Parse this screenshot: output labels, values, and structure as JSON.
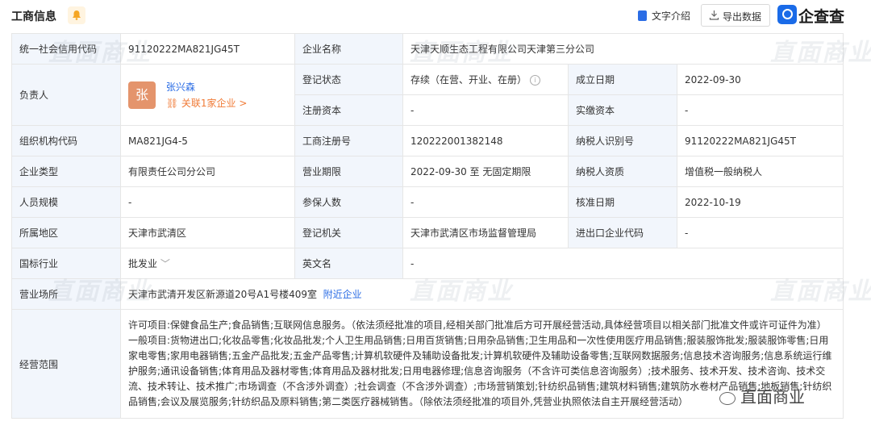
{
  "header": {
    "title": "工商信息",
    "text_intro": "文字介绍",
    "export": "导出数据",
    "logo": "企查查"
  },
  "row1": {
    "l1": "统一社会信用代码",
    "v1": "91120222MA821JG45T",
    "l2": "企业名称",
    "v2": "天津天顺生态工程有限公司天津第三分公司"
  },
  "row2": {
    "l1": "负责人",
    "avatar": "张",
    "person": "张兴森",
    "related": "关联1家企业 >",
    "l2": "登记状态",
    "v2": "存续（在营、开业、在册）",
    "l3": "成立日期",
    "v3": "2022-09-30"
  },
  "row3": {
    "l2": "注册资本",
    "v2": "-",
    "l3": "实缴资本",
    "v3": "-"
  },
  "row4": {
    "l1": "组织机构代码",
    "v1": "MA821JG4-5",
    "l2": "工商注册号",
    "v2": "120222001382148",
    "l3": "纳税人识别号",
    "v3": "91120222MA821JG45T"
  },
  "row5": {
    "l1": "企业类型",
    "v1": "有限责任公司分公司",
    "l2": "营业期限",
    "v2": "2022-09-30 至 无固定期限",
    "l3": "纳税人资质",
    "v3": "增值税一般纳税人"
  },
  "row6": {
    "l1": "人员规模",
    "v1": "-",
    "l2": "参保人数",
    "v2": "-",
    "l3": "核准日期",
    "v3": "2022-10-19"
  },
  "row7": {
    "l1": "所属地区",
    "v1": "天津市武清区",
    "l2": "登记机关",
    "v2": "天津市武清区市场监督管理局",
    "l3": "进出口企业代码",
    "v3": "-"
  },
  "row8": {
    "l1": "国标行业",
    "v1": "批发业",
    "l2": "英文名",
    "v2": "-"
  },
  "row9": {
    "l1": "营业场所",
    "v1": "天津市武清开发区新源道20号A1号楼409室",
    "link": "附近企业"
  },
  "row10": {
    "l1": "经营范围",
    "v1": "许可项目:保健食品生产;食品销售;互联网信息服务。（依法须经批准的项目,经相关部门批准后方可开展经营活动,具体经营项目以相关部门批准文件或许可证件为准）一般项目:货物进出口;化妆品零售;化妆品批发;个人卫生用品销售;日用百货销售;日用杂品销售;卫生用品和一次性使用医疗用品销售;服装服饰批发;服装服饰零售;日用家电零售;家用电器销售;五金产品批发;五金产品零售;计算机软硬件及辅助设备批发;计算机软硬件及辅助设备零售;互联网数据服务;信息技术咨询服务;信息系统运行维护服务;通讯设备销售;体育用品及器材零售;体育用品及器材批发;日用电器修理;信息咨询服务（不含许可类信息咨询服务）;技术服务、技术开发、技术咨询、技术交流、技术转让、技术推广;市场调查（不含涉外调查）;社会调查（不含涉外调查）;市场营销策划;针纺织品销售;建筑材料销售;建筑防水卷材产品销售;地板销售;针纺织品销售;会议及展览服务;针纺织品及原料销售;第二类医疗器械销售。（除依法须经批准的项目外,凭营业执照依法自主开展经营活动）"
  },
  "watermark": "直面商业"
}
